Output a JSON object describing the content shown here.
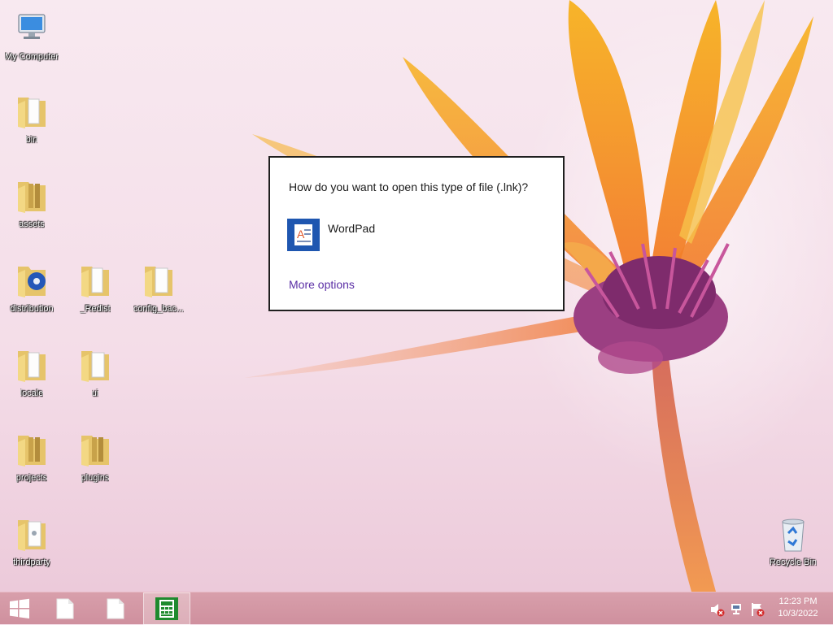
{
  "desktop": {
    "icons": [
      {
        "label": "My Computer",
        "icon": "computer-icon"
      },
      {
        "label": "bin",
        "icon": "folder-icon"
      },
      {
        "label": "assets",
        "icon": "folder-icon"
      },
      {
        "label": "distribution",
        "icon": "folder-icon"
      },
      {
        "label": "_Redist",
        "icon": "folder-icon"
      },
      {
        "label": "config_bac...",
        "icon": "folder-icon"
      },
      {
        "label": "locale",
        "icon": "folder-icon"
      },
      {
        "label": "ui",
        "icon": "folder-icon"
      },
      {
        "label": "projects",
        "icon": "folder-icon"
      },
      {
        "label": "plugins",
        "icon": "folder-icon"
      },
      {
        "label": "thirdparty",
        "icon": "folder-icon"
      },
      {
        "label": "Recycle Bin",
        "icon": "recycle-bin-icon"
      }
    ]
  },
  "dialog": {
    "title": "How do you want to open this type of file (.lnk)?",
    "app_name": "WordPad",
    "app_icon": "wordpad-icon",
    "more_options": "More options"
  },
  "taskbar": {
    "start_icon": "windows-logo-icon",
    "apps": [
      {
        "icon": "document-icon"
      },
      {
        "icon": "document-icon"
      },
      {
        "icon": "calculator-icon",
        "active": true
      }
    ],
    "tray": {
      "icons": [
        "volume-muted-icon",
        "network-icon",
        "action-center-icon"
      ],
      "time": "12:23 PM",
      "date": "10/3/2022"
    }
  },
  "colors": {
    "link": "#5b2fa5",
    "app_tile": "#1e56b0",
    "taskbar": "#d89fab"
  }
}
